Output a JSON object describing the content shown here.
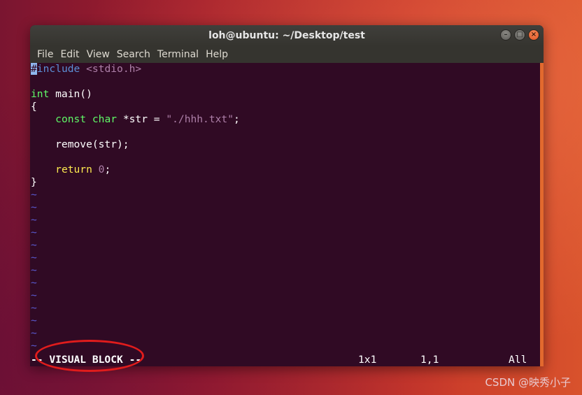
{
  "window": {
    "title": "loh@ubuntu: ~/Desktop/test",
    "controls": {
      "minimize": "–",
      "maximize": "□",
      "close": "×"
    }
  },
  "menubar": {
    "items": [
      "File",
      "Edit",
      "View",
      "Search",
      "Terminal",
      "Help"
    ]
  },
  "editor": {
    "code": {
      "include_hash": "#",
      "include_kw": "include",
      "include_path": "<stdio.h>",
      "main_type": "int",
      "main_sig": " main()",
      "open_brace": "{",
      "decl_indent": "    ",
      "decl_const": "const",
      "decl_char": "char",
      "decl_rest": " *str = ",
      "decl_string": "\"./hhh.txt\"",
      "decl_end": ";",
      "remove_line": "    remove(str);",
      "return_kw": "return",
      "return_val": "0",
      "return_end": ";",
      "close_brace": "}"
    },
    "tilde": "~",
    "tilde_count": 13
  },
  "statusline": {
    "mode": "-- VISUAL BLOCK --",
    "selection": "1x1",
    "position": "1,1",
    "scroll": "All"
  },
  "watermark": "CSDN @映秀小子",
  "colors": {
    "terminal_bg": "#300a24",
    "type_keyword": "#5ff967",
    "statement_keyword": "#fce94f",
    "string": "#ad7fa8",
    "preprocessor": "#5c8fd6",
    "tilde": "#5a5ad0",
    "annotation": "#e01c1c",
    "close_button": "#e05221"
  }
}
